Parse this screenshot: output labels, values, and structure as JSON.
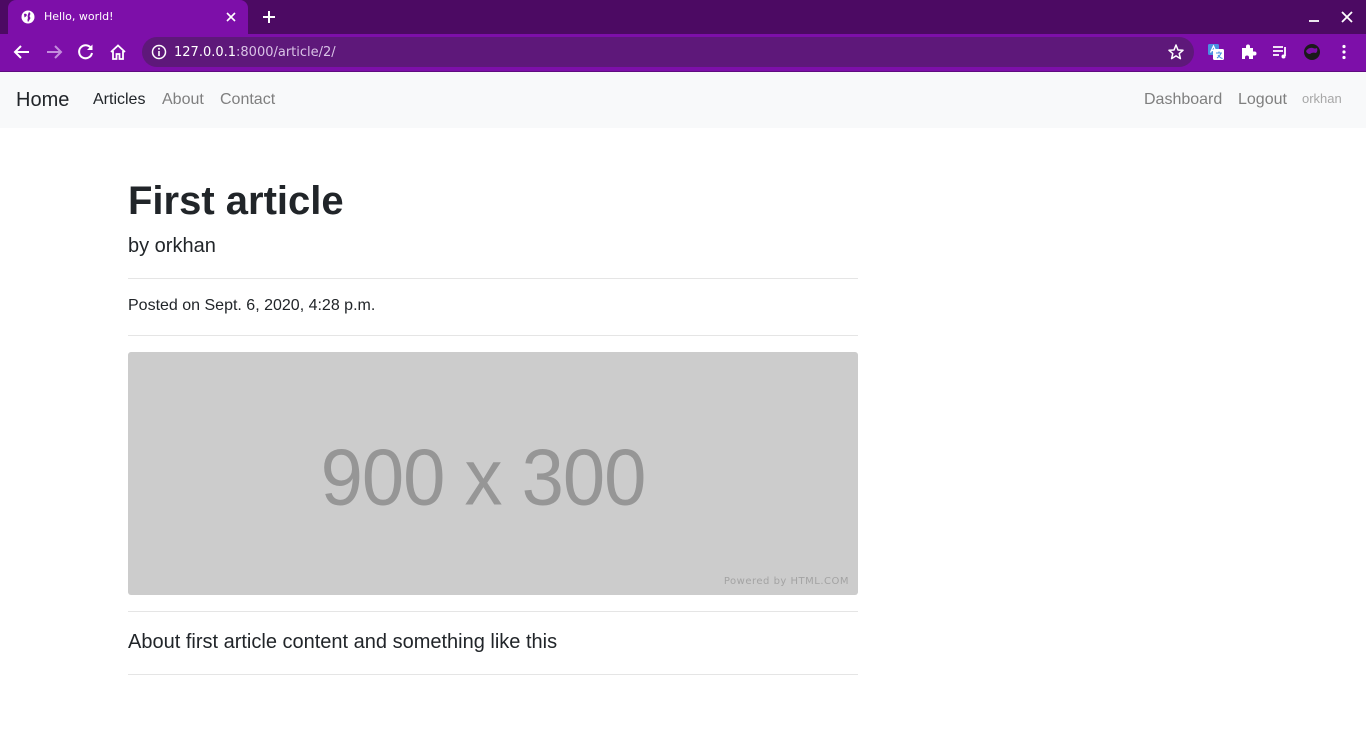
{
  "browser": {
    "tab_title": "Hello, world!",
    "url_host": "127.0.0.1",
    "url_rest": ":8000/article/2/",
    "icons": [
      "globe-icon",
      "close-icon",
      "plus-icon",
      "minimize-icon",
      "back-icon",
      "forward-icon",
      "reload-icon",
      "home-icon",
      "info-icon",
      "star-icon",
      "translate-icon",
      "extensions-icon",
      "reading-list-icon",
      "profile-icon",
      "menu-icon"
    ],
    "colors": {
      "tabbar": "#4c0a63",
      "toolbar": "#7d0fa9",
      "omnibox": "#5e187a"
    }
  },
  "navbar": {
    "brand": "Home",
    "links": {
      "articles": "Articles",
      "about": "About",
      "contact": "Contact"
    },
    "right": {
      "dashboard": "Dashboard",
      "logout": "Logout",
      "user": "orkhan"
    }
  },
  "article": {
    "title": "First article",
    "byline": "by orkhan",
    "posted": "Posted on Sept. 6, 2020, 4:28 p.m.",
    "image": {
      "label": "900 x 300",
      "credit": "Powered by HTML.COM"
    },
    "content": "About first article content and something like this"
  }
}
